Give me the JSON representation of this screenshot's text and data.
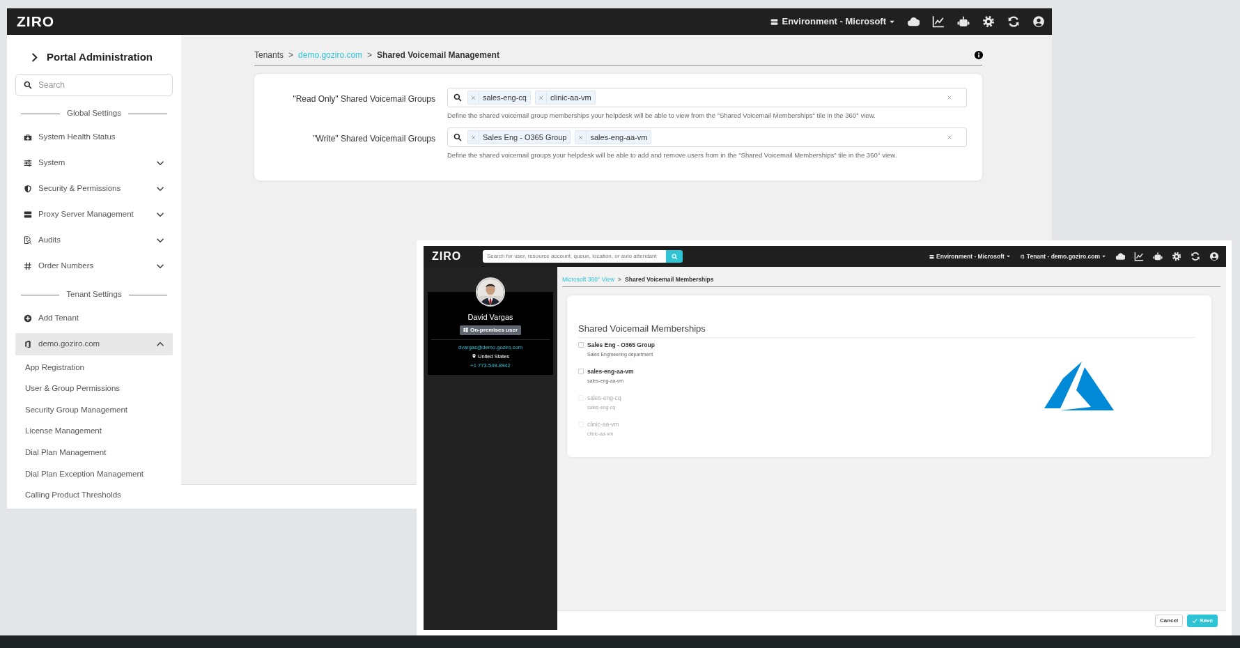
{
  "main_window": {
    "logo": "ZIRO",
    "environment_menu": "Environment - Microsoft",
    "sidebar": {
      "title": "Portal Administration",
      "search": {
        "placeholder": "Search"
      },
      "groups": [
        {
          "heading": "Global Settings",
          "items": [
            {
              "label": "System Health Status",
              "selected": false
            },
            {
              "label": "System",
              "selected": false,
              "expanded": false
            },
            {
              "label": "Security & Permissions",
              "selected": false,
              "expanded": false
            },
            {
              "label": "Proxy Server Management",
              "selected": false,
              "expanded": false
            },
            {
              "label": "Audits",
              "selected": false,
              "expanded": false
            },
            {
              "label": "Order Numbers",
              "selected": false,
              "expanded": false
            }
          ]
        },
        {
          "heading": "Tenant Settings",
          "items": [
            {
              "label": "Add Tenant",
              "selected": false
            },
            {
              "label": "demo.goziro.com",
              "selected": true,
              "expanded": true,
              "children": [
                {
                  "label": "App Registration",
                  "selected": false
                },
                {
                  "label": "User & Group Permissions",
                  "selected": false
                },
                {
                  "label": "Security Group Management",
                  "selected": false
                },
                {
                  "label": "License Management",
                  "selected": false
                },
                {
                  "label": "Dial Plan Management",
                  "selected": false
                },
                {
                  "label": "Dial Plan Exception Management",
                  "selected": false
                },
                {
                  "label": "Calling Product Thresholds",
                  "selected": false
                }
              ]
            }
          ]
        }
      ]
    },
    "breadcrumb": {
      "separator": ">",
      "items": [
        {
          "text": "Tenants",
          "kind": "plain"
        },
        {
          "text": "demo.goziro.com",
          "kind": "link"
        },
        {
          "text": "Shared Voicemail Management",
          "kind": "current"
        }
      ]
    },
    "form": {
      "rows": [
        {
          "label": "\"Read Only\" Shared Voicemail Groups",
          "tags": [
            "sales-eng-cq",
            "clinic-aa-vm"
          ],
          "hint": "Define the shared voicemail group memberships your helpdesk will be able to view from the \"Shared Voicemail Memberships\" tile in the 360° view."
        },
        {
          "label": "\"Write\" Shared Voicemail Groups",
          "tags": [
            "Sales Eng - O365 Group",
            "sales-eng-aa-vm"
          ],
          "hint": "Define the shared voicemail groups your helpdesk will be able to add and remove users from in the \"Shared Voicemail Memberships\" tile in the 360° view."
        }
      ]
    }
  },
  "overlay_window": {
    "logo": "ZIRO",
    "search": {
      "placeholder": "Search for user, resource account, queue, location, or auto attendant"
    },
    "environment_menu": "Environment - Microsoft",
    "tenant_menu": "Tenant - demo.goziro.com",
    "profile": {
      "name": "David Vargas",
      "badge": "On-premises user",
      "email": "dvargas@demo.goziro.com",
      "location": "United States",
      "phone": "+1 773-549-8942"
    },
    "breadcrumb": {
      "separator": ">",
      "items": [
        {
          "text": "Microsoft 360° View",
          "kind": "link"
        },
        {
          "text": "Shared Voicemail Memberships",
          "kind": "current"
        }
      ]
    },
    "card_title": "Shared Voicemail Memberships",
    "memberships": [
      {
        "name": "Sales Eng - O365 Group",
        "description": "Sales Engineering department",
        "checked": false,
        "disabled": false
      },
      {
        "name": "sales-eng-aa-vm",
        "description": "sales-eng-aa-vm",
        "checked": false,
        "disabled": false
      },
      {
        "name": "sales-eng-cq",
        "description": "sales-eng-cq",
        "checked": false,
        "disabled": true
      },
      {
        "name": "clinic-aa-vm",
        "description": "clinic-aa-vm",
        "checked": false,
        "disabled": true
      }
    ],
    "buttons": [
      {
        "label": "Cancel",
        "kind": "secondary"
      },
      {
        "label": "Save",
        "kind": "primary"
      }
    ]
  }
}
